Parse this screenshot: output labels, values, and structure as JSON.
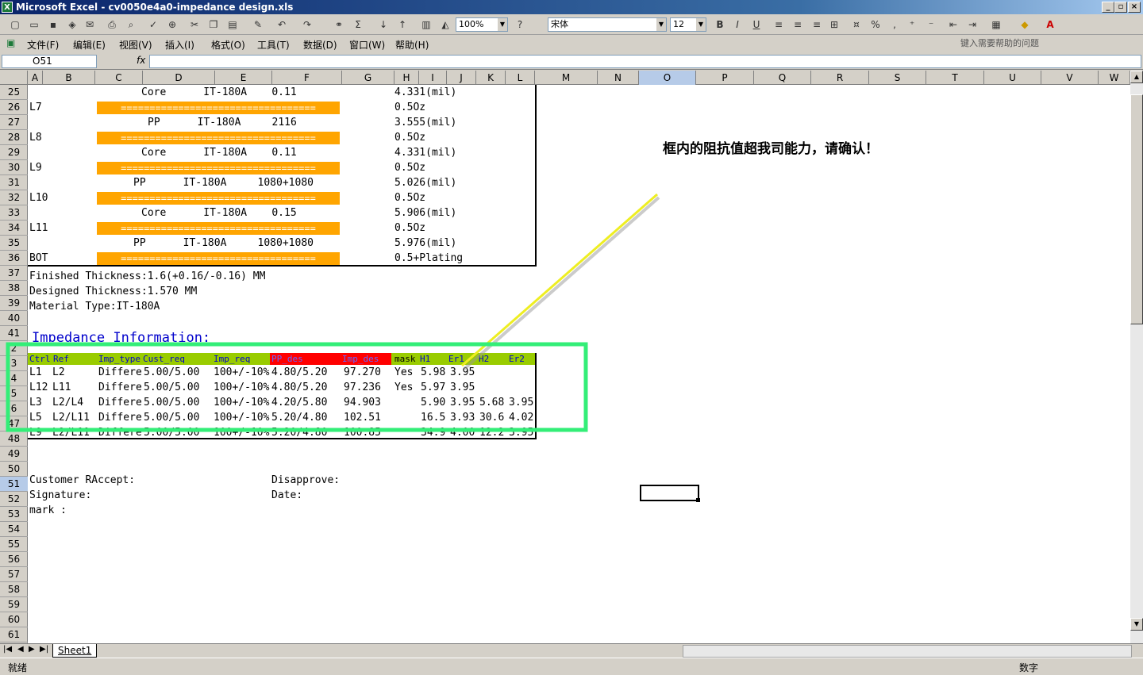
{
  "window": {
    "title": "Microsoft Excel - cv0050e4a0-impedance design.xls",
    "app_icon": "excel-icon",
    "buttons": [
      "_",
      "▫",
      "×"
    ]
  },
  "toolbar": {
    "zoom": "100%",
    "font": "宋体",
    "size": "12",
    "bold": "B",
    "italic": "I",
    "underline": "U",
    "percent": "%",
    "comma": ","
  },
  "menu": {
    "items": [
      "文件(F)",
      "编辑(E)",
      "视图(V)",
      "插入(I)",
      "格式(O)",
      "工具(T)",
      "数据(D)",
      "窗口(W)",
      "帮助(H)"
    ],
    "help_placeholder": "键入需要帮助的问题"
  },
  "formula": {
    "namebox": "O51",
    "fx": "fx"
  },
  "columns": [
    "A",
    "B",
    "C",
    "D",
    "E",
    "F",
    "G",
    "H",
    "I",
    "J",
    "K",
    "L",
    "M",
    "N",
    "O",
    "P",
    "Q",
    "R",
    "S",
    "T",
    "U",
    "V",
    "W"
  ],
  "rows": [
    "25",
    "26",
    "27",
    "28",
    "29",
    "30",
    "31",
    "32",
    "33",
    "34",
    "35",
    "36",
    "37",
    "38",
    "39",
    "40",
    "41",
    "2",
    "3",
    "4",
    "5",
    "6",
    "47",
    "48",
    "49",
    "50",
    "51",
    "52",
    "53",
    "54",
    "55",
    "56",
    "57",
    "58",
    "59",
    "60",
    "61"
  ],
  "stackup": [
    {
      "row": "25",
      "text": "Core      IT-180A    0.11",
      "value": "4.331(mil)"
    },
    {
      "row": "26",
      "layer": "L7",
      "value": "0.5Oz"
    },
    {
      "row": "27",
      "text": "PP      IT-180A     2116",
      "value": "3.555(mil)"
    },
    {
      "row": "28",
      "layer": "L8",
      "value": "0.5Oz"
    },
    {
      "row": "29",
      "text": "Core      IT-180A    0.11",
      "value": "4.331(mil)"
    },
    {
      "row": "30",
      "layer": "L9",
      "value": "0.5Oz"
    },
    {
      "row": "31",
      "text": "PP      IT-180A     1080+1080",
      "value": "5.026(mil)"
    },
    {
      "row": "32",
      "layer": "L10",
      "value": "0.5Oz"
    },
    {
      "row": "33",
      "text": "Core      IT-180A    0.15",
      "value": "5.906(mil)"
    },
    {
      "row": "34",
      "layer": "L11",
      "value": "0.5Oz"
    },
    {
      "row": "35",
      "text": "PP      IT-180A     1080+1080",
      "value": "5.976(mil)"
    },
    {
      "row": "36",
      "layer": "BOT",
      "value": "0.5+Plating"
    }
  ],
  "separator": "==================================",
  "info": {
    "finished": "Finished Thickness:1.6(+0.16/-0.16) MM",
    "designed": "Designed Thickness:1.570 MM",
    "material": "Material Type:IT-180A",
    "impedance_title": "Impedance Information:"
  },
  "imp_table": {
    "headers": [
      "Ctrl",
      "Ref",
      "Imp_type",
      "Cust_req",
      "Imp_req",
      "PP_des",
      "Imp_des",
      "mask",
      "H1",
      "Er1",
      "H2",
      "Er2"
    ],
    "rows": [
      [
        "L1",
        "L2",
        "Differe",
        "5.00/5.00",
        "100+/-10%",
        "4.80/5.20",
        "97.270",
        "Yes",
        "5.98",
        "3.95",
        "",
        ""
      ],
      [
        "L12",
        "L11",
        "Differe",
        "5.00/5.00",
        "100+/-10%",
        "4.80/5.20",
        "97.236",
        "Yes",
        "5.97",
        "3.95",
        "",
        ""
      ],
      [
        "L3",
        "L2/L4",
        "Differe",
        "5.00/5.00",
        "100+/-10%",
        "4.20/5.80",
        "94.903",
        "",
        "5.90",
        "3.95",
        "5.68",
        "3.95"
      ],
      [
        "L5",
        "L2/L11",
        "Differe",
        "5.00/5.00",
        "100+/-10%",
        "5.20/4.80",
        "102.51",
        "",
        "16.5",
        "3.93",
        "30.6",
        "4.02"
      ],
      [
        "L9",
        "L2/L11",
        "Differe",
        "5.00/5.00",
        "100+/-10%",
        "5.20/4.80",
        "100.85",
        "",
        "34.9",
        "4.00",
        "12.2",
        "3.95"
      ]
    ]
  },
  "footer": {
    "customer": "Customer R\u0001Accept:",
    "disapprove": "Disapprove:",
    "signature": "Signature:",
    "date": "Date:",
    "mark": "mark :"
  },
  "annotation": {
    "text": "框内的阻抗值超我司能力，请确认！",
    "box_color": "#33ee77",
    "line_color": "#eeee22"
  },
  "tabs": [
    "Sheet1"
  ],
  "status": {
    "left": "就绪",
    "right": "数字"
  }
}
